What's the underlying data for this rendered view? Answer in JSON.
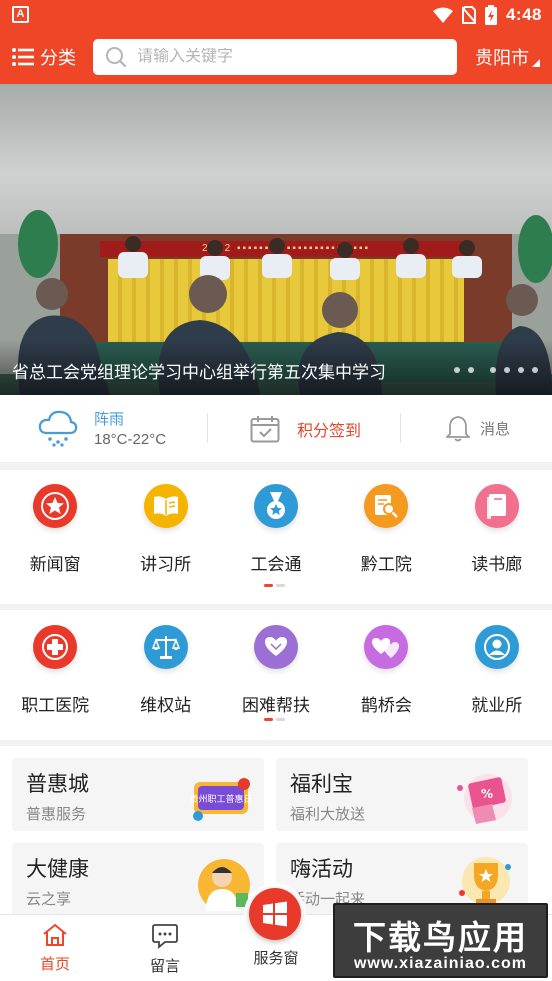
{
  "status_bar": {
    "app_badge": "A",
    "time": "4:48"
  },
  "header": {
    "category_label": "分类",
    "search_placeholder": "请输入关键字",
    "city": "贵阳市"
  },
  "banner": {
    "caption": "省总工会党组理论学习中心组举行第五次集中学习",
    "screen_text": "2022 ",
    "dot_count": 6
  },
  "info_bar": {
    "weather_condition": "阵雨",
    "weather_temp": "18°C-22°C",
    "checkin_label": "积分签到",
    "message_label": "消息"
  },
  "grid_1": {
    "items": [
      {
        "label": "新闻窗",
        "icon": "star-icon",
        "color": "#e8392a"
      },
      {
        "label": "讲习所",
        "icon": "book-icon",
        "color": "#f4b400"
      },
      {
        "label": "工会通",
        "icon": "medal-icon",
        "color": "#2f9bd6"
      },
      {
        "label": "黔工院",
        "icon": "doc-search-icon",
        "color": "#f39a1f"
      },
      {
        "label": "读书廊",
        "icon": "books-icon",
        "color": "#f0708d"
      }
    ]
  },
  "grid_2": {
    "items": [
      {
        "label": "职工医院",
        "icon": "medical-cross-icon",
        "color": "#e8392a"
      },
      {
        "label": "维权站",
        "icon": "scales-icon",
        "color": "#2f9bd6"
      },
      {
        "label": "困难帮扶",
        "icon": "heart-hand-icon",
        "color": "#9b6fd4"
      },
      {
        "label": "鹊桥会",
        "icon": "hearts-icon",
        "color": "#c66ce0"
      },
      {
        "label": "就业所",
        "icon": "person-icon",
        "color": "#2f9bd6"
      }
    ]
  },
  "cards": [
    {
      "title": "普惠城",
      "subtitle": "普惠服务",
      "art": "shopping-promo-art",
      "art_text": "贵州职工普惠日"
    },
    {
      "title": "福利宝",
      "subtitle": "福利大放送",
      "art": "gift-coupon-art"
    },
    {
      "title": "大健康",
      "subtitle": "云之享",
      "art": "doctor-art"
    },
    {
      "title": "嗨活动",
      "subtitle": "活动一起来",
      "art": "trophy-art"
    }
  ],
  "tab_bar": {
    "home": "首页",
    "message": "留言",
    "service": "服务窗",
    "active_color": "#ee4626"
  },
  "watermark": {
    "title": "下载鸟应用",
    "url": "www.xiazainiao.com"
  }
}
